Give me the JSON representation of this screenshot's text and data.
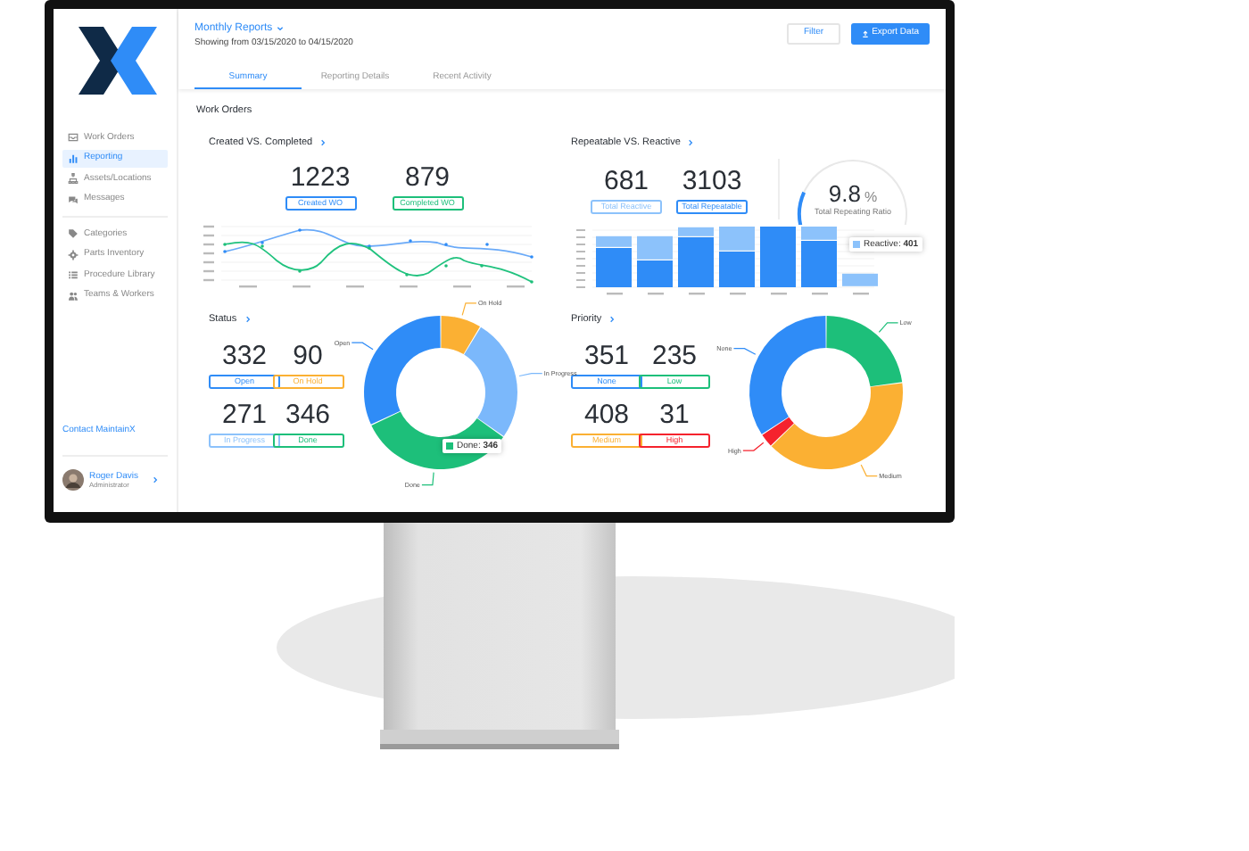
{
  "sidebar": {
    "nav_groups": [
      [
        {
          "label": "Work Orders",
          "selected": false
        },
        {
          "label": "Reporting",
          "selected": true
        },
        {
          "label": "Assets/Locations",
          "selected": false
        },
        {
          "label": "Messages",
          "selected": false
        }
      ],
      [
        {
          "label": "Categories",
          "selected": false
        },
        {
          "label": "Parts Inventory",
          "selected": false
        },
        {
          "label": "Procedure Library",
          "selected": false
        },
        {
          "label": "Teams & Workers",
          "selected": false
        }
      ]
    ],
    "contact_link": "Contact MaintainX",
    "user": {
      "name": "Roger Davis",
      "role": "Administrator"
    }
  },
  "header": {
    "report_menu": "Monthly Reports",
    "date_range": "Showing from 03/15/2020 to 04/15/2020",
    "buttons": [
      {
        "label": "Filter",
        "kind": "outline"
      },
      {
        "label": "Export Data",
        "kind": "primary"
      }
    ]
  },
  "tabs": [
    {
      "label": "Summary",
      "selected": true
    },
    {
      "label": "Reporting Details",
      "selected": false
    },
    {
      "label": "Recent Activity",
      "selected": false
    }
  ],
  "section_title": "Work Orders",
  "created_vs_completed": {
    "title": "Created VS. Completed",
    "stats": [
      {
        "value": "1223",
        "label": "Created WO",
        "color": "#2f8cf7"
      },
      {
        "value": "879",
        "label": "Completed WO",
        "color": "#1dbf7a"
      }
    ]
  },
  "repeatable_vs_reactive": {
    "title": "Repeatable VS. Reactive",
    "stats": [
      {
        "value": "681",
        "label": "Total Reactive",
        "color": "#8cc2fb"
      },
      {
        "value": "3103",
        "label": "Total Repeatable",
        "color": "#2f8cf7"
      }
    ],
    "ratio": {
      "value": "9.8",
      "unit": "%",
      "label": "Total Repeating Ratio"
    },
    "tooltip": "Reactive: **401**"
  },
  "status": {
    "title": "Status",
    "stats": [
      {
        "value": "332",
        "label": "Open",
        "color": "#2f8cf7"
      },
      {
        "value": "90",
        "label": "On Hold",
        "color": "#fbb033"
      },
      {
        "value": "271",
        "label": "In Progress",
        "color": "#8cc2fb"
      },
      {
        "value": "346",
        "label": "Done",
        "color": "#1dbf7a"
      }
    ],
    "slices": [
      {
        "label": "On Hold",
        "color": "#fbb033"
      },
      {
        "label": "In Progress",
        "color": "#7bb8fb"
      },
      {
        "label": "Done",
        "color": "#1dbf7a"
      },
      {
        "label": "Open",
        "color": "#2f8cf7"
      }
    ],
    "tooltip": "Done: **346**"
  },
  "priority": {
    "title": "Priority",
    "stats": [
      {
        "value": "351",
        "label": "None",
        "color": "#2f8cf7"
      },
      {
        "value": "235",
        "label": "Low",
        "color": "#1dbf7a"
      },
      {
        "value": "408",
        "label": "Medium",
        "color": "#fbb033"
      },
      {
        "value": "31",
        "label": "High",
        "color": "#f5222d"
      }
    ],
    "slices": [
      {
        "label": "Low",
        "color": "#1dbf7a"
      },
      {
        "label": "Medium",
        "color": "#fbb033"
      },
      {
        "label": "High",
        "color": "#f5222d"
      },
      {
        "label": "None",
        "color": "#2f8cf7"
      }
    ]
  }
}
